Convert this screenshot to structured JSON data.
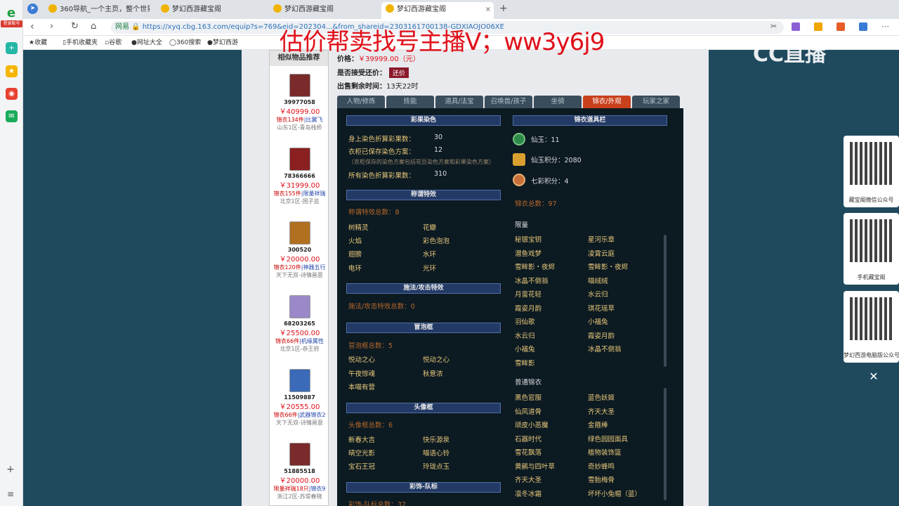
{
  "browser": {
    "login_badge": "登录账号",
    "tabs": [
      {
        "label": "360导航_一个主页，整个世界",
        "active": false
      },
      {
        "label": "梦幻西游藏宝阁",
        "active": false
      },
      {
        "label": "梦幻西游藏宝阁",
        "active": false
      },
      {
        "label": "梦幻西游藏宝阁",
        "active": true
      }
    ],
    "address": {
      "zone": "网易",
      "url": "https://xyq.cbg.163.com/equip?s=769&eid=202304...&from_shareid=2303161700138-GDXIAOJO06XE"
    },
    "bookmarks": [
      "收藏",
      "手机收藏夹",
      "谷歌",
      "网址大全",
      "360搜索",
      "梦幻西游"
    ]
  },
  "overlay": {
    "promo": "估价帮卖找号主播V；ww3y6j9",
    "logo": "CC直播"
  },
  "side": {
    "header": "相似物品推荐",
    "items": [
      {
        "id": "39977058",
        "price": "￥40999.00",
        "desc": "锦衣134件",
        "tag": "|比翼飞",
        "server": "山东1区-青岛栈桥"
      },
      {
        "id": "78366666",
        "price": "￥31999.00",
        "desc": "锦衣155件",
        "tag": "|限量祥瑞",
        "server": "北京1区-国子监"
      },
      {
        "id": "300520",
        "price": "￥20000.00",
        "desc": "锦衣120件",
        "tag": "|神器五行",
        "server": "天下无双-诗情画意"
      },
      {
        "id": "68203265",
        "price": "￥25500.00",
        "desc": "锦衣66件",
        "tag": "|机缘属性",
        "server": "北京1区-恭王府"
      },
      {
        "id": "11509887",
        "price": "￥20555.00",
        "desc": "锦衣66件",
        "tag": "|武器锦衣2",
        "server": "天下无双-诗情画意"
      },
      {
        "id": "51885518",
        "price": "￥20000.00",
        "desc": "限量祥瑞18只",
        "tag": "|锦衣9",
        "server": "浙江2区-苏堤春晓"
      }
    ]
  },
  "info": {
    "price_label": "价格：",
    "price": "￥39999.00（元）",
    "haggle_label": "是否接受还价：",
    "haggle_btn": "还价",
    "time_label": "出售剩余时间：",
    "time": "13天22时"
  },
  "tabs": [
    "人物/修炼",
    "技能",
    "道具/法宝",
    "召唤兽/孩子",
    "坐骑",
    "锦衣/外观",
    "玩家之家"
  ],
  "dye": {
    "title": "彩果染色",
    "rows": [
      {
        "label": "身上染色折算彩果数：",
        "value": "30"
      },
      {
        "label": "衣柜已保存染色方案：",
        "value": "12"
      },
      {
        "label": "（衣柜保存的染色方案包括花豆染色方案和彩果染色方案）",
        "value": ""
      },
      {
        "label": "所有染色折算彩果数：",
        "value": "310"
      }
    ]
  },
  "title_effects": {
    "title": "称谓特效",
    "total": "称谓特效总数：8",
    "items": [
      "树精灵",
      "花瓣",
      "火焰",
      "彩色泡泡",
      "翅膀",
      "水环",
      "电环",
      "光环"
    ]
  },
  "attack_effects": {
    "title": "施法/攻击特效",
    "total": "施法/攻击特效总数：0"
  },
  "bubble": {
    "title": "冒泡框",
    "total": "冒泡框总数：5",
    "items": [
      "悦动之心",
      "悦动之心",
      "午夜惊魂",
      "秋意浓",
      "本喵有营"
    ]
  },
  "avatar_frame": {
    "title": "头像框",
    "total": "头像框总数：6",
    "items": [
      "新春大吉",
      "快乐源泉",
      "晴空光影",
      "喵语心铃",
      "宝石王冠",
      "玲珑点玉"
    ]
  },
  "decor": {
    "title": "彩饰-队标",
    "total": "彩饰-队标总数：32"
  },
  "wardrobe": {
    "title": "锦衣道具栏",
    "props": [
      {
        "label": "仙玉：",
        "value": "11"
      },
      {
        "label": "仙玉积分：",
        "value": "2080"
      },
      {
        "label": "七彩积分：",
        "value": "4"
      }
    ],
    "total": "锦衣总数：97",
    "limited_title": "限量",
    "limited": [
      "秘银宝钥",
      "星河乐章",
      "潜鱼戏梦",
      "凌霄云庭",
      "雪眸影・夜烬",
      "雪眸影・夜烬",
      "冰晶不倒翁",
      "喵绒绒",
      "月蛮花轻",
      "水云归",
      "霞姿月韵",
      "琪花瑶草",
      "羽仙歌",
      "小福兔",
      "水云归",
      "霞姿月韵",
      "小福兔",
      "冰晶不倒翁",
      "雪眸影"
    ],
    "normal_title": "普通锦衣",
    "normal": [
      "黑色官服",
      "蓝色妖姬",
      "仙风道骨",
      "齐天大圣",
      "顽皮小恶魔",
      "金箍棒",
      "石器时代",
      "绿色园园面具",
      "雪花飘落",
      "植物装饰篮",
      "黄鹂与四叶草",
      "奇妙蜂鸣",
      "齐天大圣",
      "雪胎梅骨",
      "凛冬冰霜",
      "坏坏小兔帽（蓝）"
    ]
  },
  "qr": [
    {
      "caption": "藏宝阁微信公众号"
    },
    {
      "caption": "手机藏宝阁"
    },
    {
      "caption": "梦幻西游电脑版公众号"
    }
  ]
}
